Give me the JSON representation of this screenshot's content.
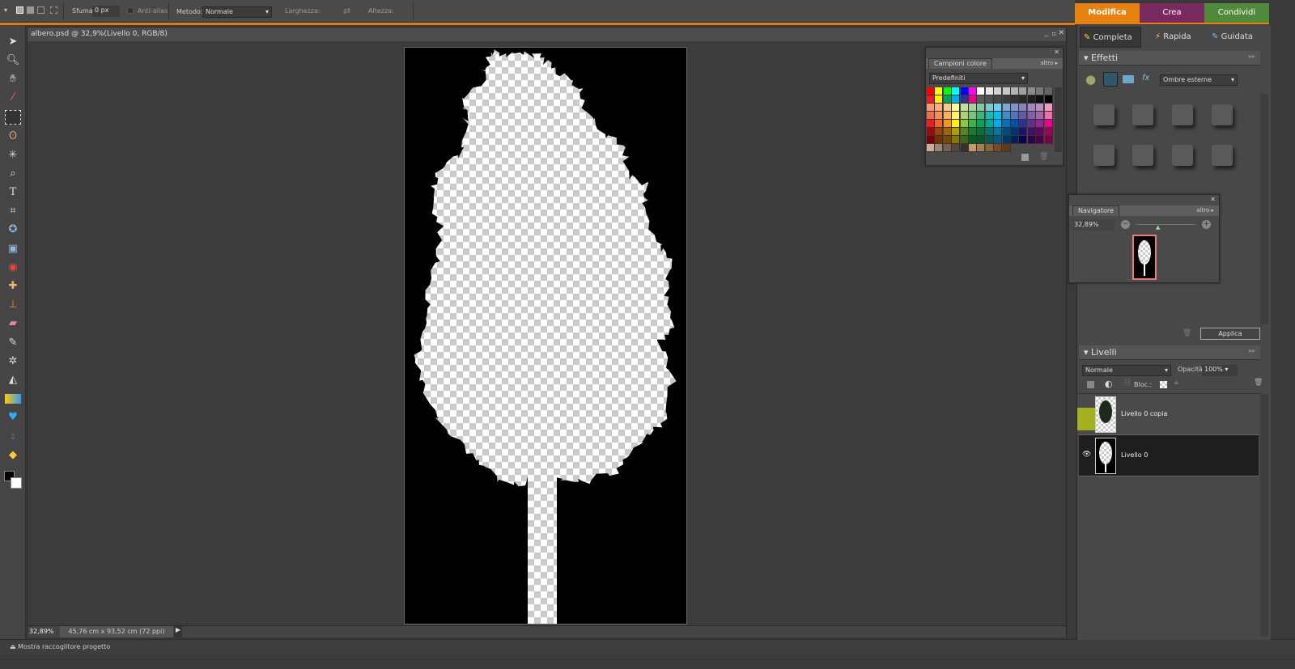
{
  "options_bar": {
    "feather_label": "Sfuma:",
    "feather_value": "0 px",
    "antialias_label": "Anti-alias",
    "method_label": "Metodo:",
    "method_value": "Normale",
    "width_label": "Larghezza:",
    "height_label": "Altezza:"
  },
  "top_tabs": [
    {
      "label": "Modifica",
      "color": "#e8820f"
    },
    {
      "label": "Crea",
      "color": "#7a2a5e"
    },
    {
      "label": "Condividi",
      "color": "#4e8a3a"
    }
  ],
  "modes": [
    {
      "label": "Completa"
    },
    {
      "label": "Rapida"
    },
    {
      "label": "Guidata"
    }
  ],
  "document": {
    "title": "albero.psd @ 32,9%(Livello 0, RGB/8)",
    "zoom": "32,89%",
    "size": "45,76 cm x 93,52 cm (72 ppi)"
  },
  "effects": {
    "title": "Effetti",
    "dropdown": "Ombre esterne",
    "apply": "Applica"
  },
  "swatches": {
    "tab": "Campioni colore",
    "more": "altro",
    "preset": "Predefiniti",
    "rows": [
      [
        "#ff0000",
        "#ffff00",
        "#00ff00",
        "#00ffff",
        "#0000ff",
        "#ff00ff",
        "#ffffff",
        "#e6e6e6",
        "#d2d2d2",
        "#c8c8c8",
        "#b4b4b4",
        "#a0a0a0",
        "#8c8c8c",
        "#787878",
        "#646464"
      ],
      [
        "#ed1c24",
        "#fff200",
        "#00a651",
        "#00aeef",
        "#2e3192",
        "#ec008c",
        "#5a5a5a",
        "#505050",
        "#464646",
        "#3c3c3c",
        "#323232",
        "#282828",
        "#1e1e1e",
        "#0f0f0f",
        "#000000"
      ],
      [
        "#f7977a",
        "#f9ad81",
        "#fdc68a",
        "#fff79a",
        "#c4df9b",
        "#a3d39c",
        "#82ca9d",
        "#7accc8",
        "#6dcff6",
        "#7da7d9",
        "#8393ca",
        "#8781bd",
        "#a187be",
        "#bd8cbf",
        "#f49ac2"
      ],
      [
        "#f26c4f",
        "#f68e55",
        "#fbaf5c",
        "#fff467",
        "#acd372",
        "#7cc576",
        "#3bb878",
        "#1abbb4",
        "#00bff3",
        "#438ccb",
        "#5574b9",
        "#605ca8",
        "#855fa8",
        "#a763a8",
        "#f06ea9"
      ],
      [
        "#ed1c24",
        "#f26522",
        "#f7941d",
        "#fff200",
        "#8dc73f",
        "#39b54a",
        "#00a651",
        "#00a99d",
        "#00aeef",
        "#0072bc",
        "#0054a6",
        "#2e3192",
        "#662d91",
        "#92278f",
        "#ec008c"
      ],
      [
        "#9e0b0f",
        "#a0410d",
        "#a3620a",
        "#aba000",
        "#598527",
        "#1a7b30",
        "#007236",
        "#00746b",
        "#0076a3",
        "#004b80",
        "#003471",
        "#1b1464",
        "#440e62",
        "#630460",
        "#9e005d"
      ],
      [
        "#790000",
        "#7b2e00",
        "#7d4900",
        "#827b00",
        "#406618",
        "#005e20",
        "#005826",
        "#005952",
        "#005b7f",
        "#003663",
        "#002157",
        "#0d004c",
        "#32004b",
        "#4b0049",
        "#7b0046"
      ],
      [
        "#c7b299",
        "#998675",
        "#736357",
        "#534741",
        "#37302d",
        "#c69c6d",
        "#a67c52",
        "#8c6239",
        "#754c24",
        "#603913"
      ]
    ]
  },
  "navigator": {
    "tab": "Navigatore",
    "more": "altro",
    "zoom": "32,89%"
  },
  "layers": {
    "title": "Livelli",
    "blend": "Normale",
    "opacity_label": "Opacità:",
    "opacity": "100%",
    "lock_label": "Bloc.:",
    "items": [
      {
        "name": "Livello 0 copia",
        "visible": false,
        "selected": false
      },
      {
        "name": "Livello 0",
        "visible": true,
        "selected": true
      }
    ]
  },
  "bottom": {
    "project_bin": "Mostra raccoglitore progetto"
  }
}
